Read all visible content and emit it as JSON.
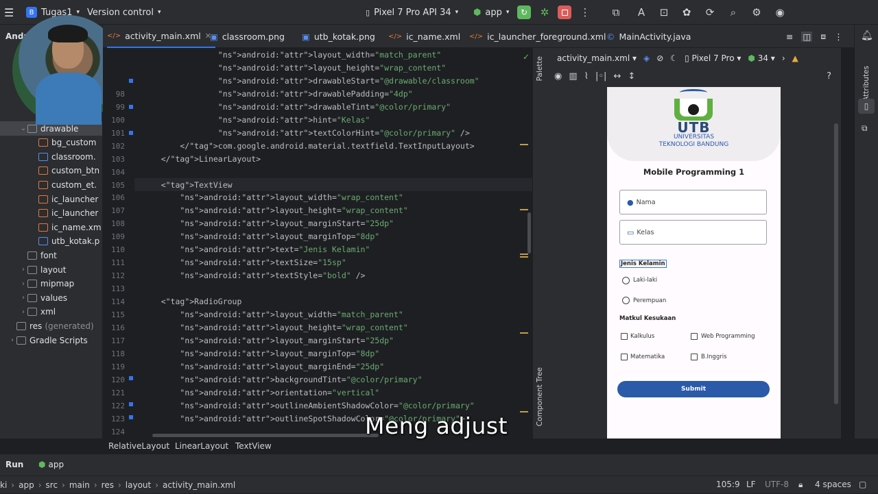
{
  "topbar": {
    "project_badge": "B",
    "project_name": "Tugas1",
    "version_control": "Version control",
    "device": "Pixel 7 Pro API 34",
    "run_config": "app"
  },
  "project_panel": {
    "header": "Andr",
    "items": [
      {
        "label": "drawable",
        "kind": "folder",
        "indent": 1
      },
      {
        "label": "bg_custom",
        "kind": "xml",
        "indent": 2
      },
      {
        "label": "classroom.",
        "kind": "img",
        "indent": 2
      },
      {
        "label": "custom_btn",
        "kind": "xml",
        "indent": 2
      },
      {
        "label": "custom_et.",
        "kind": "xml",
        "indent": 2
      },
      {
        "label": "ic_launcher",
        "kind": "xml",
        "indent": 2
      },
      {
        "label": "ic_launcher",
        "kind": "xml",
        "indent": 2
      },
      {
        "label": "ic_name.xm",
        "kind": "xml",
        "indent": 2
      },
      {
        "label": "utb_kotak.p",
        "kind": "img",
        "indent": 2
      },
      {
        "label": "font",
        "kind": "folder",
        "indent": 1
      },
      {
        "label": "layout",
        "kind": "folder",
        "indent": 1
      },
      {
        "label": "mipmap",
        "kind": "folder",
        "indent": 1
      },
      {
        "label": "values",
        "kind": "folder",
        "indent": 1
      },
      {
        "label": "xml",
        "kind": "folder",
        "indent": 1
      },
      {
        "label": "res",
        "suffix": "(generated)",
        "kind": "folder",
        "indent": 0
      },
      {
        "label": "Gradle Scripts",
        "kind": "gradle",
        "indent": 0
      }
    ]
  },
  "tabs": [
    {
      "label": "activity_main.xml",
      "active": true
    },
    {
      "label": "classroom.png"
    },
    {
      "label": "utb_kotak.png"
    },
    {
      "label": "ic_name.xml"
    },
    {
      "label": "ic_launcher_foreground.xml"
    },
    {
      "label": "MainActivity.java"
    }
  ],
  "code_lines": [
    {
      "n": "",
      "t": "                android:layout_width=\"match_parent\""
    },
    {
      "n": "",
      "t": "                android:layout_height=\"wrap_content\""
    },
    {
      "n": "",
      "t": "                android:drawableStart=\"@drawable/classroom\""
    },
    {
      "n": "98",
      "t": "                android:drawablePadding=\"4dp\""
    },
    {
      "n": "99",
      "t": "                android:drawableTint=\"@color/primary\""
    },
    {
      "n": "100",
      "t": "                android:hint=\"Kelas\""
    },
    {
      "n": "101",
      "t": "                android:textColorHint=\"@color/primary\" />"
    },
    {
      "n": "102",
      "t": "        </com.google.android.material.textfield.TextInputLayout>"
    },
    {
      "n": "103",
      "t": "    </LinearLayout>"
    },
    {
      "n": "104",
      "t": ""
    },
    {
      "n": "105",
      "t": "    <TextView"
    },
    {
      "n": "106",
      "t": "        android:layout_width=\"wrap_content\""
    },
    {
      "n": "107",
      "t": "        android:layout_height=\"wrap_content\""
    },
    {
      "n": "108",
      "t": "        android:layout_marginStart=\"25dp\""
    },
    {
      "n": "109",
      "t": "        android:layout_marginTop=\"8dp\""
    },
    {
      "n": "110",
      "t": "        android:text=\"Jenis Kelamin\""
    },
    {
      "n": "111",
      "t": "        android:textSize=\"15sp\""
    },
    {
      "n": "112",
      "t": "        android:textStyle=\"bold\" />"
    },
    {
      "n": "113",
      "t": ""
    },
    {
      "n": "114",
      "t": "    <RadioGroup"
    },
    {
      "n": "115",
      "t": "        android:layout_width=\"match_parent\""
    },
    {
      "n": "116",
      "t": "        android:layout_height=\"wrap_content\""
    },
    {
      "n": "117",
      "t": "        android:layout_marginStart=\"25dp\""
    },
    {
      "n": "118",
      "t": "        android:layout_marginTop=\"8dp\""
    },
    {
      "n": "119",
      "t": "        android:layout_marginEnd=\"25dp\""
    },
    {
      "n": "120",
      "t": "        android:backgroundTint=\"@color/primary\""
    },
    {
      "n": "121",
      "t": "        android:orientation=\"vertical\""
    },
    {
      "n": "122",
      "t": "        android:outlineAmbientShadowColor=\"@color/primary\""
    },
    {
      "n": "123",
      "t": "        android:outlineSpotShadowColor=\"@color/primary\">"
    },
    {
      "n": "124",
      "t": ""
    }
  ],
  "design": {
    "file": "activity_main.xml",
    "device": "Pixel 7 Pro",
    "api": "34",
    "palette_label": "Palette",
    "component_tree_label": "Component Tree",
    "attributes_label": "Attributes"
  },
  "phone": {
    "logo_text": "UTB",
    "logo_sub1": "UNIVERSITAS",
    "logo_sub2": "TEKNOLOGI BANDUNG",
    "title": "Mobile Programming 1",
    "nama_hint": "Nama",
    "kelas_hint": "Kelas",
    "jenis_kelamin": "Jenis Kelamin",
    "radio1": "Laki-laki",
    "radio2": "Perempuan",
    "matkul": "Matkul Kesukaan",
    "cb1": "Kalkulus",
    "cb2": "Web Programming",
    "cb3": "Matematika",
    "cb4": "B.Inggris",
    "submit": "Submit",
    "primary_color": "#2a5aa8"
  },
  "breadcrumb": [
    "RelativeLayout",
    "LinearLayout",
    "TextView"
  ],
  "run": {
    "label": "Run",
    "config": "app"
  },
  "bottom": {
    "path": [
      "ki",
      "app",
      "src",
      "main",
      "res",
      "layout",
      "activity_main.xml"
    ],
    "position": "105:9",
    "line_sep": "LF",
    "encoding": "UTF-8",
    "indent": "4 spaces"
  },
  "subtitle": "Meng adjust"
}
